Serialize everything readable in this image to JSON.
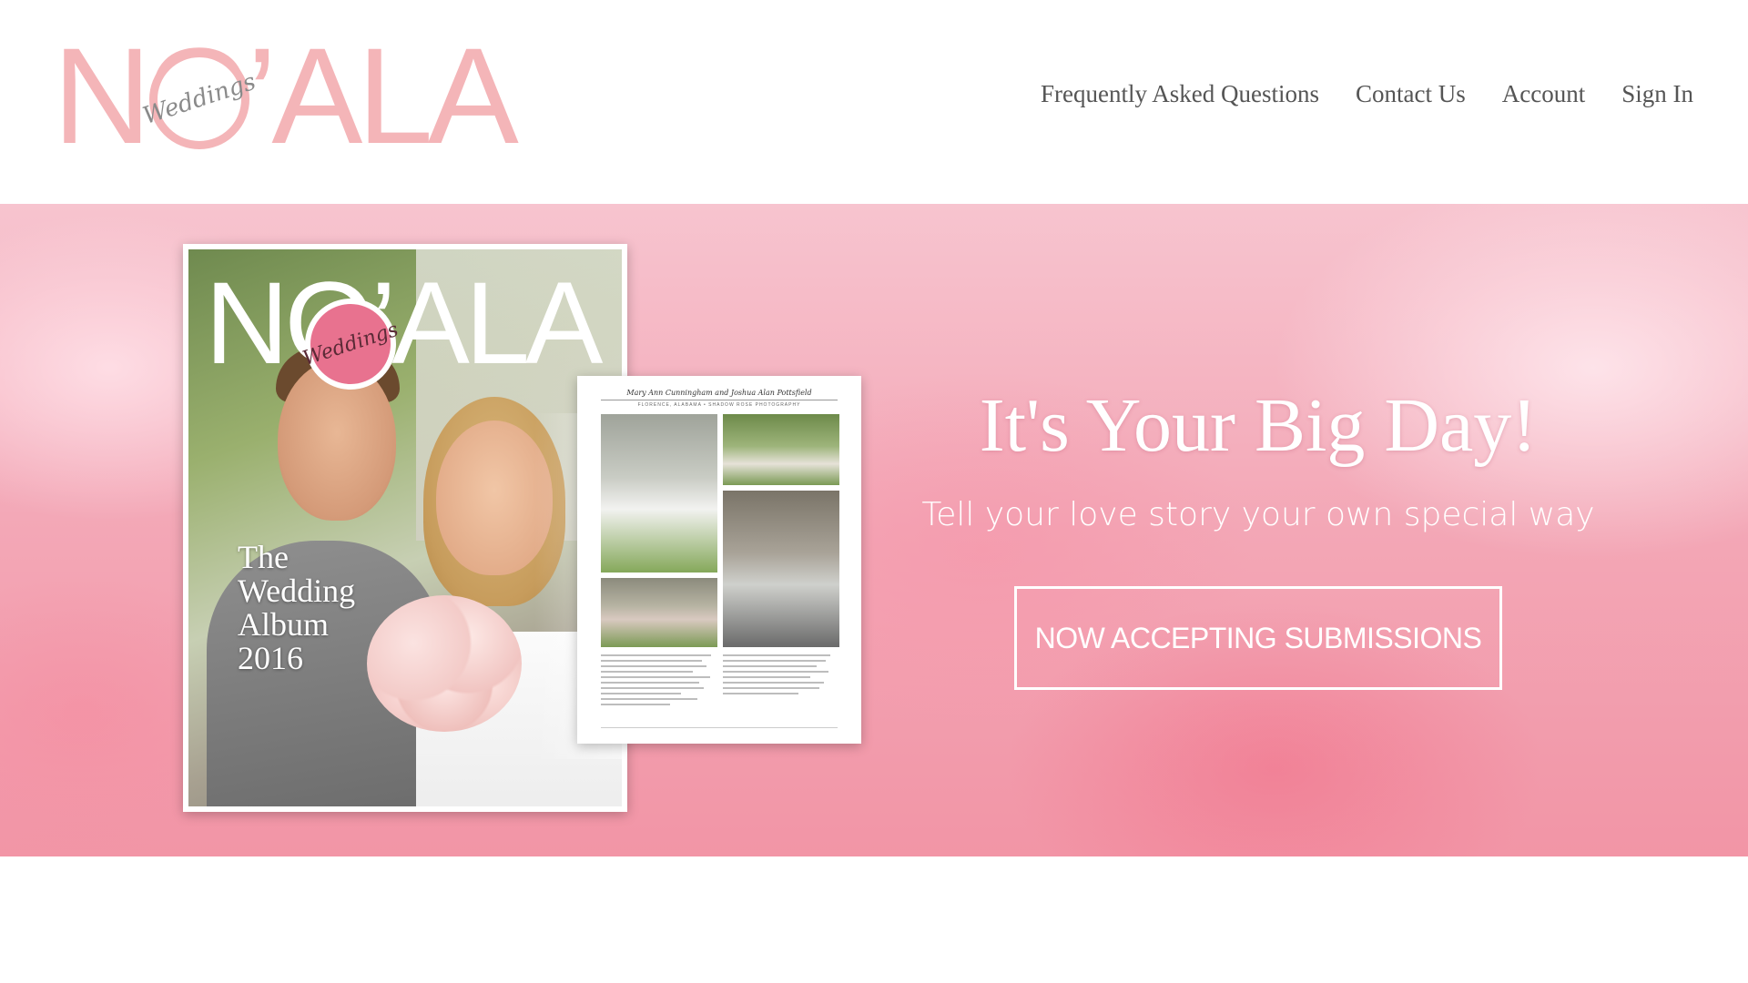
{
  "header": {
    "logo": {
      "wordmark": "NO’ALA",
      "script": "Weddings"
    },
    "nav": [
      {
        "label": "Frequently Asked Questions"
      },
      {
        "label": "Contact Us"
      },
      {
        "label": "Account"
      },
      {
        "label": "Sign In"
      }
    ]
  },
  "hero": {
    "title": "It's Your Big Day!",
    "subtitle": "Tell your love story your own special way",
    "cta_label": "NOW ACCEPTING SUBMISSIONS",
    "magazine": {
      "wordmark": "NO’ALA",
      "script": "Weddings",
      "title_lines": [
        "The",
        "Wedding",
        "Album",
        "2016"
      ]
    },
    "spread": {
      "couple": "Mary Ann Cunningham and Joshua Alan Pottsfield",
      "credit": "FLORENCE, ALABAMA • SHADOW ROSE PHOTOGRAPHY"
    }
  },
  "colors": {
    "brand_pink": "#f4b5b8",
    "nav_text": "#555555",
    "hero_pink": "#f3a7b6",
    "cover_ring": "#e8728f"
  },
  "icons": []
}
